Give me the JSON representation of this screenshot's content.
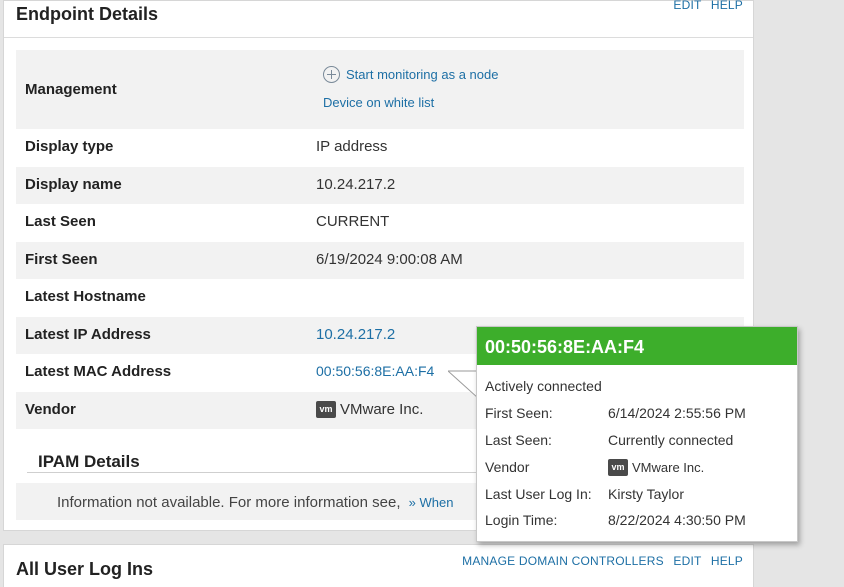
{
  "endpoint_panel": {
    "title": "Endpoint Details",
    "links": {
      "edit": "EDIT",
      "help": "HELP"
    },
    "management": {
      "label": "Management",
      "start_monitoring": "Start monitoring as a node",
      "white_list": "Device on white list"
    },
    "rows": [
      {
        "label": "Display type",
        "value": "IP address"
      },
      {
        "label": "Display name",
        "value": "10.24.217.2"
      },
      {
        "label": "Last Seen",
        "value": "CURRENT"
      },
      {
        "label": "First Seen",
        "value": "6/19/2024 9:00:08 AM"
      },
      {
        "label": "Latest Hostname",
        "value": ""
      },
      {
        "label": "Latest IP Address",
        "value": "10.24.217.2"
      },
      {
        "label": "Latest MAC Address",
        "value": "00:50:56:8E:AA:F4"
      },
      {
        "label": "Vendor",
        "value": "VMware Inc.",
        "icon": "vmware-icon"
      }
    ],
    "ipam": {
      "title": "IPAM Details",
      "info": "Information not available. For more information see,",
      "link": "» When"
    }
  },
  "user_logins_panel": {
    "title": "All User Log Ins",
    "links": {
      "manage": "MANAGE DOMAIN CONTROLLERS",
      "edit": "EDIT",
      "help": "HELP"
    }
  },
  "mac_popup": {
    "title": "00:50:56:8E:AA:F4",
    "status": "Actively connected",
    "header_color": "#3dae2b",
    "rows": [
      {
        "key": "First Seen:",
        "value": "6/14/2024 2:55:56 PM"
      },
      {
        "key": "Last Seen:",
        "value": "Currently connected"
      },
      {
        "key": "Vendor",
        "value": "VMware Inc.",
        "icon": "vmware-icon"
      },
      {
        "key": "Last User Log In:",
        "value": "Kirsty Taylor"
      },
      {
        "key": "Login Time:",
        "value": "8/22/2024 4:30:50 PM"
      }
    ]
  }
}
